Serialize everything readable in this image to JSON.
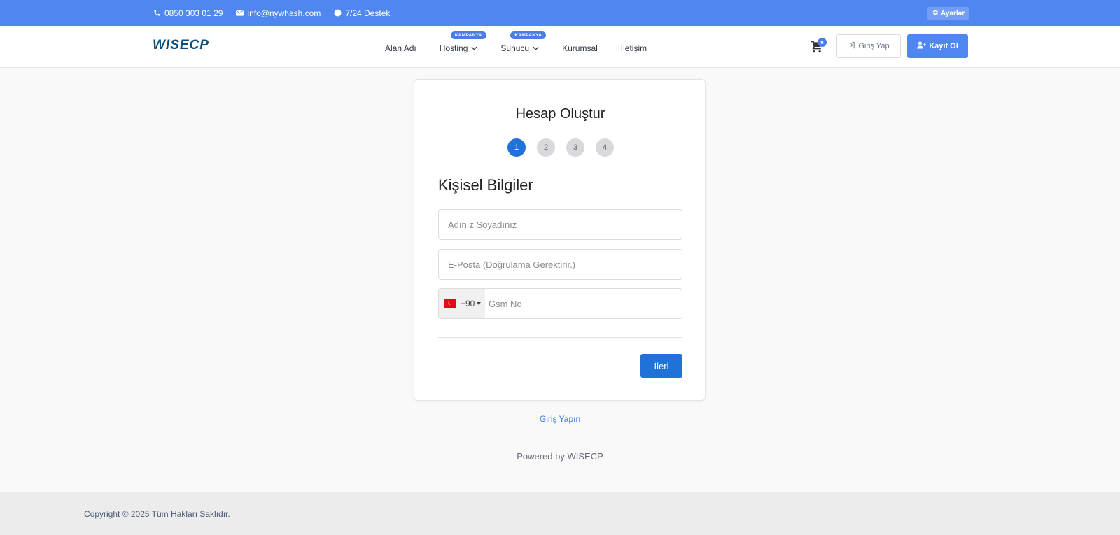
{
  "topbar": {
    "phone": "0850 303 01 29",
    "email": "info@nywhash.com",
    "support": "7/24 Destek",
    "settings_label": "Ayarlar",
    "icons": [
      "phone-icon",
      "mail-icon",
      "clock-icon",
      "gear-icon"
    ]
  },
  "header": {
    "logo": "WISECP",
    "nav": [
      {
        "label": "Alan Adı"
      },
      {
        "label": "Hosting",
        "badge": "KAMPANYA"
      },
      {
        "label": "Sunucu",
        "badge": "KAMPANYA"
      },
      {
        "label": "Kurumsal"
      },
      {
        "label": "İletişim"
      }
    ],
    "cart_count": "0",
    "login_label": "Giriş Yap",
    "register_label": "Kayıt Ol"
  },
  "card": {
    "title": "Hesap Oluştur",
    "steps": [
      "1",
      "2",
      "3",
      "4"
    ],
    "active_step": "1",
    "section_title": "Kişisel Bilgiler",
    "name_placeholder": "Adınız Soyadınız",
    "email_placeholder": "E-Posta (Doğrulama Gerektirir.)",
    "phone_code": "+90",
    "phone_placeholder": "Gsm No",
    "next_label": "İleri"
  },
  "links": {
    "signin": "Giriş Yapın",
    "powered": "Powered by WISECP"
  },
  "footer": {
    "copyright": "Copyright © 2025 Tüm Hakları Saklıdır."
  },
  "colors": {
    "topbar": "#5086f0",
    "primary": "#1f73d8",
    "accent": "#4a7de8"
  }
}
